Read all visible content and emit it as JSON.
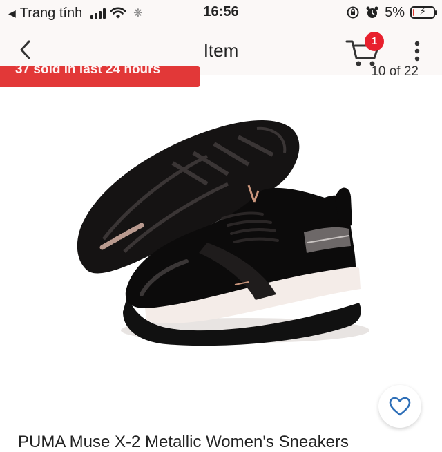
{
  "status_bar": {
    "back_app": "Trang tính",
    "time": "16:56",
    "battery": "5%",
    "battery_level": 0.05,
    "icons": [
      "signal-icon",
      "wifi-icon",
      "loading-icon",
      "orientation-lock-icon",
      "alarm-icon",
      "battery-charging-icon"
    ]
  },
  "header": {
    "title": "Item",
    "cart_count": "1",
    "icons": [
      "back-chevron-icon",
      "cart-icon",
      "more-vertical-icon"
    ]
  },
  "banner": {
    "sold_text": "37 sold in last 24 hours",
    "image_counter": "10 of 22"
  },
  "product": {
    "title": "PUMA Muse X-2 Metallic Women's Sneakers",
    "image_alt": "black-womens-sneakers-photo"
  },
  "colors": {
    "accent_red": "#e23838",
    "badge_red": "#e8202d",
    "favorite_blue": "#2e6fb8"
  }
}
